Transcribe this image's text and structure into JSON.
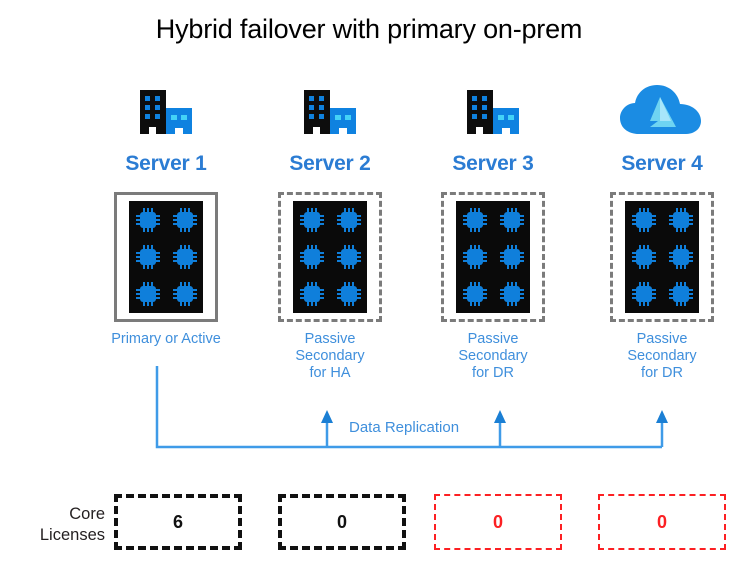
{
  "title": "Hybrid failover with primary on-prem",
  "accent_blue": "#2b7cd3",
  "caption_blue": "#3f8fdc",
  "red": "#fc2023",
  "columns": [
    {
      "name": "Server 1",
      "icon": "on-prem-building-icon",
      "border": "solid",
      "cores": 6,
      "caption": "Primary or Active",
      "caption_lines": [
        "Primary or Active"
      ],
      "license_value": "6",
      "license_style": "black"
    },
    {
      "name": "Server 2",
      "icon": "on-prem-building-icon",
      "border": "dashed",
      "cores": 6,
      "caption": "Passive Secondary for HA",
      "caption_lines": [
        "Passive",
        "Secondary",
        "for HA"
      ],
      "license_value": "0",
      "license_style": "black"
    },
    {
      "name": "Server 3",
      "icon": "on-prem-building-icon",
      "border": "dashed",
      "cores": 6,
      "caption": "Passive Secondary for DR",
      "caption_lines": [
        "Passive",
        "Secondary",
        "for DR"
      ],
      "license_value": "0",
      "license_style": "red"
    },
    {
      "name": "Server 4",
      "icon": "azure-cloud-icon",
      "border": "dashed",
      "cores": 6,
      "caption": "Passive Secondary for DR",
      "caption_lines": [
        "Passive",
        "Secondary",
        "for DR"
      ],
      "license_value": "0",
      "license_style": "red"
    }
  ],
  "replication": {
    "label": "Data Replication",
    "source": "Server 1",
    "targets": [
      "Server 2",
      "Server 3",
      "Server 4"
    ]
  },
  "core_licenses": {
    "label_line1": "Core",
    "label_line2": "Licenses"
  }
}
